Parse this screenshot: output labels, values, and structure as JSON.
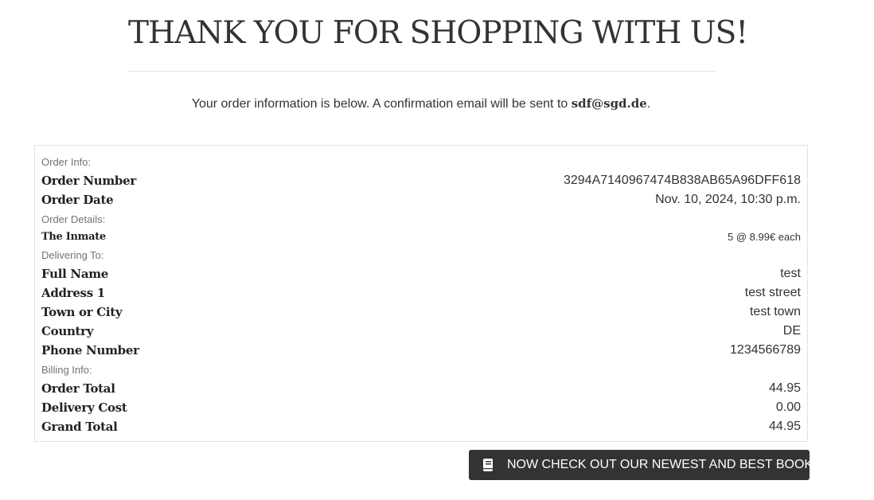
{
  "header": {
    "title": "THANK YOU FOR SHOPPING WITH US!"
  },
  "intro": {
    "text_before": "Your order information is below. A confirmation email will be sent to ",
    "email": "sdf@sgd.de",
    "text_after": "."
  },
  "order_info": {
    "section_label": "Order Info:",
    "rows": [
      {
        "label": "Order Number",
        "value": "3294A7140967474B838AB65A96DFF618"
      },
      {
        "label": "Order Date",
        "value": "Nov. 10, 2024, 10:30 p.m."
      }
    ]
  },
  "order_details": {
    "section_label": "Order Details:",
    "items": [
      {
        "label": "The Inmate",
        "value": "5 @ 8.99€ each"
      }
    ]
  },
  "delivering_to": {
    "section_label": "Delivering To:",
    "rows": [
      {
        "label": "Full Name",
        "value": "test"
      },
      {
        "label": "Address 1",
        "value": "test street"
      },
      {
        "label": "Town or City",
        "value": "test town"
      },
      {
        "label": "Country",
        "value": "DE"
      },
      {
        "label": "Phone Number",
        "value": "1234566789"
      }
    ]
  },
  "billing_info": {
    "section_label": "Billing Info:",
    "rows": [
      {
        "label": "Order Total",
        "value": "44.95"
      },
      {
        "label": "Delivery Cost",
        "value": "0.00"
      },
      {
        "label": "Grand Total",
        "value": "44.95"
      }
    ]
  },
  "cta": {
    "label": "NOW CHECK OUT OUR NEWEST AND BEST BOOKS!",
    "icon": "book-icon"
  },
  "colors": {
    "button_bg": "#333333",
    "muted_label": "#6c757d",
    "border": "#e3e3e3"
  }
}
